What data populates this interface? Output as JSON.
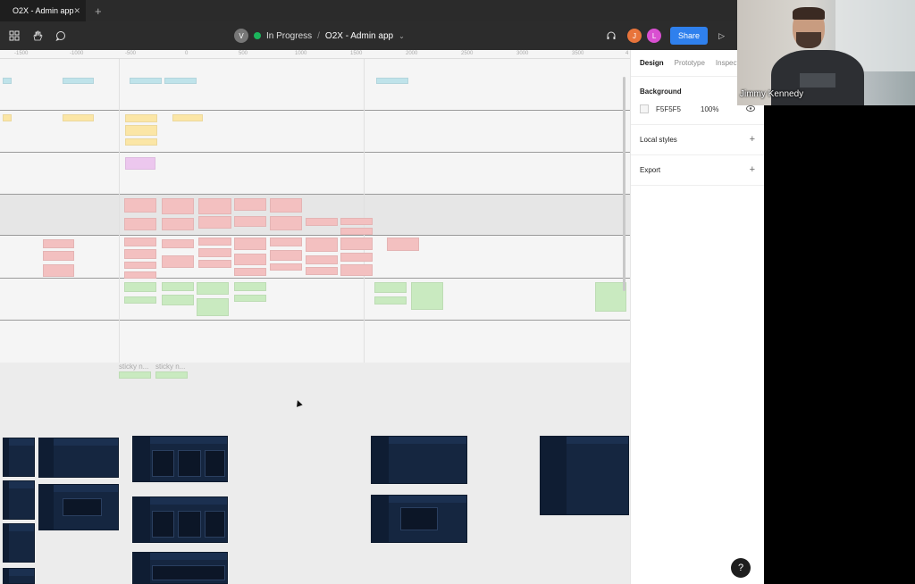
{
  "browser": {
    "tab_title": "O2X - Admin app",
    "tab_close": "✕",
    "new_tab": "+"
  },
  "toolbar": {
    "user_initial": "V",
    "status": "In Progress",
    "separator": "/",
    "file_name": "O2X - Admin app",
    "chevron": "⌄",
    "collaborators": [
      {
        "initial": "J",
        "color": "#e8743b"
      },
      {
        "initial": "L",
        "color": "#d94fd1"
      }
    ],
    "share_label": "Share",
    "play": "▷",
    "icons": {
      "menu": "grid-icon",
      "hand": "hand-icon",
      "comment": "comment-icon",
      "headphones": "headphones-icon"
    }
  },
  "ruler": {
    "ticks": [
      "-1500",
      "-1000",
      "-500",
      "0",
      "500",
      "1000",
      "1500",
      "2000",
      "2500",
      "3000",
      "3500",
      "4"
    ]
  },
  "canvas": {
    "sticky_labels": [
      "sticky n...",
      "sticky n..."
    ]
  },
  "panel": {
    "tabs": [
      "Design",
      "Prototype",
      "Inspect"
    ],
    "background_title": "Background",
    "background_hex": "F5F5F5",
    "background_opacity": "100%",
    "local_styles": "Local styles",
    "export": "Export",
    "plus": "+"
  },
  "help": "?",
  "webcam": {
    "participant_name": "Jimmy Kennedy"
  }
}
